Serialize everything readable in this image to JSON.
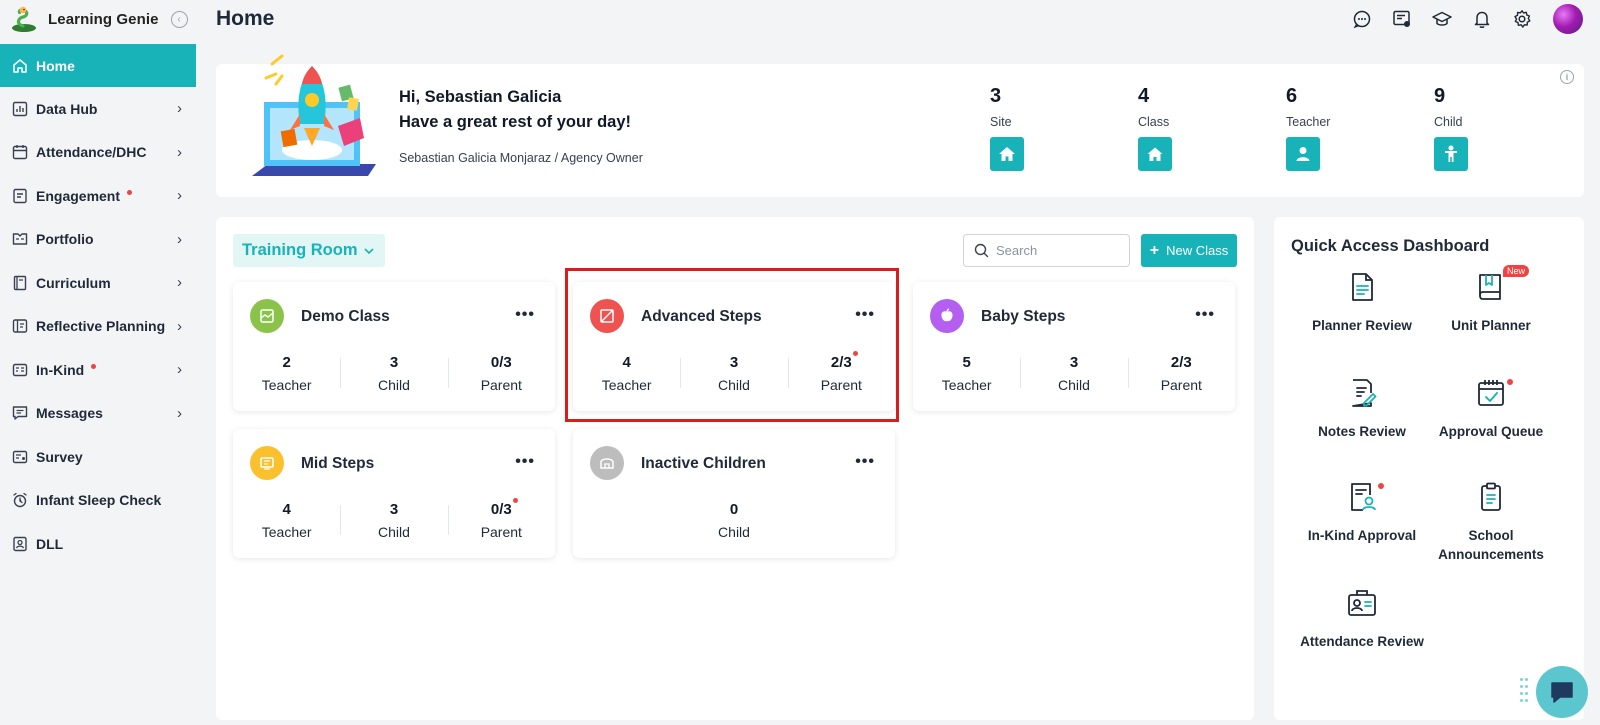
{
  "app": {
    "name": "Learning Genie",
    "page_title": "Home"
  },
  "sidebar": {
    "items": [
      {
        "label": "Home",
        "icon": "home-icon",
        "active": true,
        "chevron": false,
        "dot": false
      },
      {
        "label": "Data Hub",
        "icon": "bar-chart-icon",
        "active": false,
        "chevron": true,
        "dot": false
      },
      {
        "label": "Attendance/DHC",
        "icon": "calendar-icon",
        "active": false,
        "chevron": true,
        "dot": false
      },
      {
        "label": "Engagement",
        "icon": "engagement-icon",
        "active": false,
        "chevron": true,
        "dot": true
      },
      {
        "label": "Portfolio",
        "icon": "portfolio-icon",
        "active": false,
        "chevron": true,
        "dot": false
      },
      {
        "label": "Curriculum",
        "icon": "book-icon",
        "active": false,
        "chevron": true,
        "dot": false
      },
      {
        "label": "Reflective Planning",
        "icon": "planning-icon",
        "active": false,
        "chevron": true,
        "dot": false
      },
      {
        "label": "In-Kind",
        "icon": "in-kind-icon",
        "active": false,
        "chevron": true,
        "dot": true
      },
      {
        "label": "Messages",
        "icon": "message-icon",
        "active": false,
        "chevron": true,
        "dot": false
      },
      {
        "label": "Survey",
        "icon": "survey-icon",
        "active": false,
        "chevron": false,
        "dot": false
      },
      {
        "label": "Infant Sleep Check",
        "icon": "alarm-clock-icon",
        "active": false,
        "chevron": false,
        "dot": false
      },
      {
        "label": "DLL",
        "icon": "dll-icon",
        "active": false,
        "chevron": false,
        "dot": false
      }
    ]
  },
  "topbar": {
    "icons": [
      "chat-icon",
      "notes-icon",
      "graduation-cap-icon",
      "bell-icon",
      "gear-icon"
    ]
  },
  "welcome": {
    "greeting": "Hi, Sebastian Galicia",
    "message": "Have a great rest of your day!",
    "role": "Sebastian Galicia Monjaraz / Agency Owner",
    "stats": [
      {
        "value": "3",
        "label": "Site",
        "icon": "house-icon"
      },
      {
        "value": "4",
        "label": "Class",
        "icon": "house-icon"
      },
      {
        "value": "6",
        "label": "Teacher",
        "icon": "person-icon"
      },
      {
        "value": "9",
        "label": "Child",
        "icon": "child-icon"
      }
    ]
  },
  "classes_panel": {
    "room": "Training Room",
    "search_placeholder": "Search",
    "new_class_label": "New Class",
    "classes": [
      {
        "name": "Demo Class",
        "color": "#8bc34a",
        "stats": [
          {
            "value": "2",
            "label": "Teacher"
          },
          {
            "value": "3",
            "label": "Child"
          },
          {
            "value": "0/3",
            "label": "Parent",
            "dot": false
          }
        ]
      },
      {
        "name": "Advanced Steps",
        "color": "#ef5350",
        "stats": [
          {
            "value": "4",
            "label": "Teacher"
          },
          {
            "value": "3",
            "label": "Child"
          },
          {
            "value": "2/3",
            "label": "Parent",
            "dot": true
          }
        ]
      },
      {
        "name": "Baby Steps",
        "color": "#b45ff0",
        "stats": [
          {
            "value": "5",
            "label": "Teacher"
          },
          {
            "value": "3",
            "label": "Child"
          },
          {
            "value": "2/3",
            "label": "Parent",
            "dot": false
          }
        ]
      },
      {
        "name": "Mid Steps",
        "color": "#fbc02d",
        "stats": [
          {
            "value": "4",
            "label": "Teacher"
          },
          {
            "value": "3",
            "label": "Child"
          },
          {
            "value": "0/3",
            "label": "Parent",
            "dot": true
          }
        ]
      },
      {
        "name": "Inactive Children",
        "color": "#bdbdbd",
        "stats": [
          {
            "value": "0",
            "label": "Child"
          }
        ]
      }
    ]
  },
  "quick_access": {
    "title": "Quick Access Dashboard",
    "items": [
      {
        "label": "Planner Review",
        "icon": "planner-review-icon",
        "dot": false,
        "badge": ""
      },
      {
        "label": "Unit Planner",
        "icon": "unit-planner-icon",
        "dot": false,
        "badge": "New"
      },
      {
        "label": "Notes Review",
        "icon": "notes-review-icon",
        "dot": false,
        "badge": ""
      },
      {
        "label": "Approval Queue",
        "icon": "approval-queue-icon",
        "dot": true,
        "badge": ""
      },
      {
        "label": "In-Kind Approval",
        "icon": "in-kind-approval-icon",
        "dot": true,
        "badge": ""
      },
      {
        "label": "School Announcements",
        "icon": "announcements-icon",
        "dot": false,
        "badge": ""
      },
      {
        "label": "Attendance Review",
        "icon": "attendance-review-icon",
        "dot": false,
        "badge": ""
      }
    ]
  },
  "colors": {
    "accent": "#17b3b8",
    "highlight": "#dc1c1c",
    "alert_dot": "#ef4444"
  }
}
